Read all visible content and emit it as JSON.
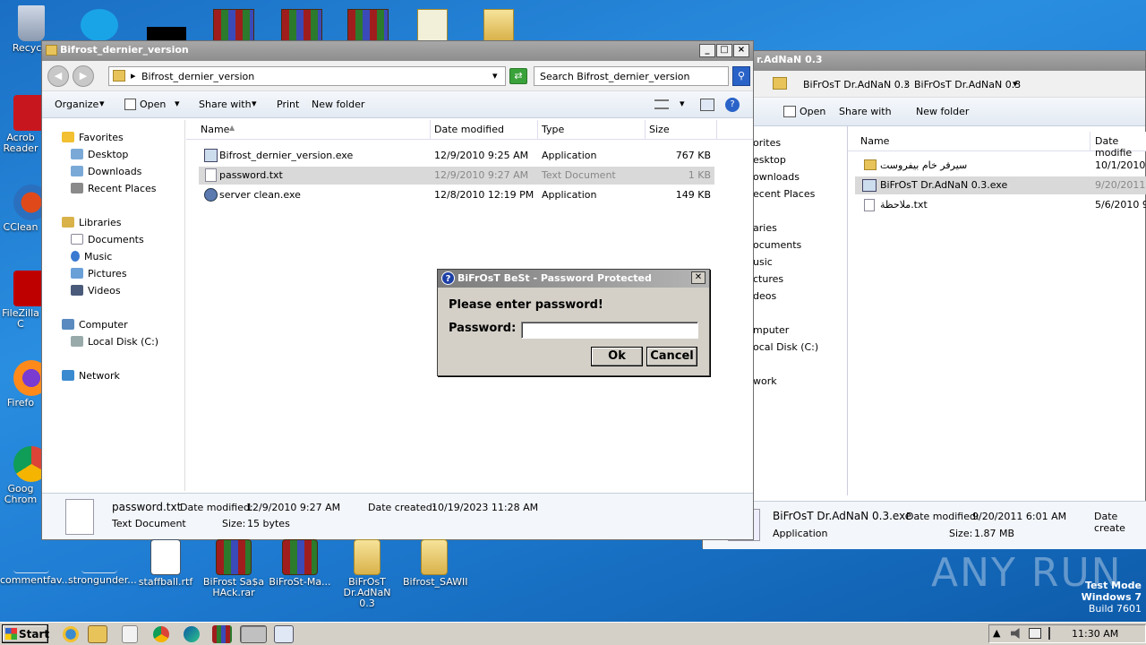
{
  "desktop": {
    "icons_left": [
      {
        "label": "Recycle"
      },
      {
        "label": "Acrob Reader"
      },
      {
        "label": "CClean"
      },
      {
        "label": "FileZilla C"
      },
      {
        "label": "Firefo"
      },
      {
        "label": "Goog Chrom"
      }
    ],
    "icons_bottom": [
      {
        "label": "commentfav..."
      },
      {
        "label": "strongunder..."
      },
      {
        "label": "staffball.rtf"
      },
      {
        "label": "BiFrost Sa$a HAck.rar"
      },
      {
        "label": "BiFroSt-Ma..."
      },
      {
        "label": "BiFrOsT Dr.AdNaN 0.3"
      },
      {
        "label": "Bifrost_SAWII"
      }
    ],
    "watermark": "ANY RUN",
    "test_mode": "Test Mode",
    "os_name": "Windows 7",
    "build": "Build 7601"
  },
  "main_window": {
    "title": "Bifrost_dernier_version",
    "address": "Bifrost_dernier_version",
    "search_placeholder": "Search Bifrost_dernier_version",
    "toolbar": {
      "organize": "Organize",
      "open": "Open",
      "share_with": "Share with",
      "print": "Print",
      "new_folder": "New folder"
    },
    "nav": {
      "favorites": "Favorites",
      "desktop": "Desktop",
      "downloads": "Downloads",
      "recent": "Recent Places",
      "libraries": "Libraries",
      "documents": "Documents",
      "music": "Music",
      "pictures": "Pictures",
      "videos": "Videos",
      "computer": "Computer",
      "local_disk": "Local Disk (C:)",
      "network": "Network"
    },
    "columns": {
      "name": "Name",
      "date": "Date modified",
      "type": "Type",
      "size": "Size"
    },
    "files": [
      {
        "name": "Bifrost_dernier_version.exe",
        "date": "12/9/2010 9:25 AM",
        "type": "Application",
        "size": "767 KB"
      },
      {
        "name": "password.txt",
        "date": "12/9/2010 9:27 AM",
        "type": "Text Document",
        "size": "1 KB"
      },
      {
        "name": "server clean.exe",
        "date": "12/8/2010 12:19 PM",
        "type": "Application",
        "size": "149 KB"
      }
    ],
    "details": {
      "filename": "password.txt",
      "modified_label": "Date modified:",
      "modified": "12/9/2010 9:27 AM",
      "created_label": "Date created:",
      "created": "10/19/2023 11:28 AM",
      "type": "Text Document",
      "size_label": "Size:",
      "size": "15 bytes"
    }
  },
  "back_window": {
    "title": "r.AdNaN 0.3",
    "crumb1": "BiFrOsT Dr.AdNaN 0.3",
    "crumb2": "BiFrOsT Dr.AdNaN 0.3",
    "toolbar": {
      "open": "Open",
      "share_with": "Share with",
      "new_folder": "New folder"
    },
    "nav": [
      "orites",
      "esktop",
      "ownloads",
      "ecent Places",
      "aries",
      "ocuments",
      "usic",
      "ctures",
      "deos",
      "mputer",
      "ocal Disk (C:)",
      "work"
    ],
    "columns": {
      "name": "Name",
      "date": "Date modifie"
    },
    "files": [
      {
        "name": "سيرفر خام بيفروست",
        "date": "10/1/2010 5"
      },
      {
        "name": "BiFrOsT Dr.AdNaN 0.3.exe",
        "date": "9/20/2011 6"
      },
      {
        "name": "ملاحظة.txt",
        "date": "5/6/2010 9:"
      }
    ],
    "details": {
      "filename": "BiFrOsT Dr.AdNaN 0.3.exe",
      "modified_label": "Date modified:",
      "modified": "9/20/2011 6:01 AM",
      "created_label": "Date create",
      "type": "Application",
      "size_label": "Size:",
      "size": "1.87 MB"
    }
  },
  "dialog": {
    "title": "BiFrOsT BeSt - Password Protected",
    "prompt": "Please enter password!",
    "password_label": "Password:",
    "password_value": "",
    "ok": "Ok",
    "cancel": "Cancel"
  },
  "taskbar": {
    "start": "Start",
    "time": "11:30 AM"
  }
}
